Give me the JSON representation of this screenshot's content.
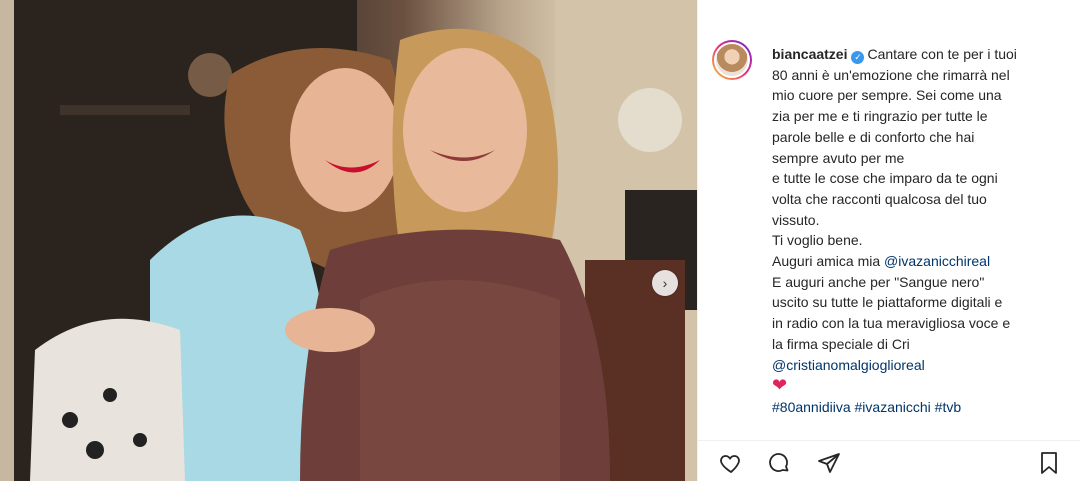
{
  "post": {
    "username": "biancaatzei",
    "verified_icon": "verified-badge-icon",
    "caption_lines": [
      "Cantare con te per i tuoi",
      "80 anni è un'emozione che rimarrà nel",
      "mio cuore per sempre. Sei come una",
      "zia per me e ti ringrazio per tutte le",
      "parole belle e di conforto che hai",
      "sempre avuto per me",
      "e tutte le cose che imparo da te ogni",
      "volta che racconti qualcosa del tuo",
      "vissuto.",
      "Ti voglio bene.",
      "Auguri amica mia",
      "@ivazanicchireal",
      "E auguri anche per \"Sangue nero\"",
      "uscito su tutte le piattaforme digitali e",
      "in radio con la tua meravigliosa voce e",
      "la firma speciale di Cri",
      "@cristianomalgioglioreal",
      "#80annidiiva",
      "#ivazanicchi",
      "#tvb"
    ],
    "heart_icon": "red-heart-emoji"
  },
  "photo": {
    "next_icon": "chevron-right-icon",
    "next_symbol": "›"
  },
  "actions": {
    "like_icon": "heart-outline-icon",
    "comment_icon": "comment-icon",
    "share_icon": "paper-plane-icon",
    "save_icon": "bookmark-icon"
  },
  "colors": {
    "link": "#003569",
    "text": "#262626",
    "verified": "#3897f0",
    "heart": "#e0245e"
  }
}
